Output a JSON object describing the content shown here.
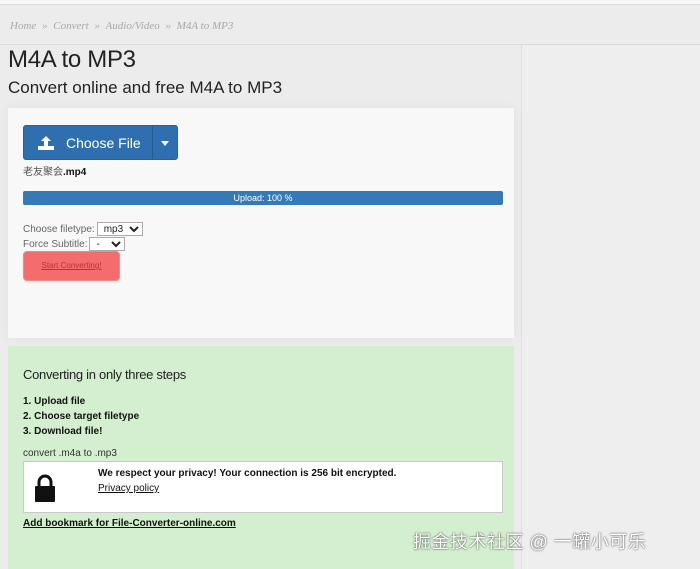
{
  "breadcrumb": [
    "Home",
    "»",
    "Convert",
    "»",
    "Audio/Video",
    "»",
    "M4A to MP3"
  ],
  "page": {
    "title": "M4A to MP3",
    "subtitle": "Convert online and free M4A to MP3"
  },
  "upload": {
    "choose_label": "Choose File",
    "upload_icon": "upload-icon",
    "filename_prefix": "老友聚会",
    "filename_ext": ".mp4",
    "progress_text": "Upload: 100 %",
    "progress_percent": 100,
    "filetype_label": "Choose filetype:",
    "filetype_value": "mp3",
    "subtitle_label": "Force Subtitle:",
    "subtitle_value": "-",
    "start_label": "Start Converting!"
  },
  "steps": {
    "title": "Converting in only three steps",
    "items": [
      "1. Upload file",
      "2. Choose target filetype",
      "3. Download file!"
    ],
    "convert_note": "convert .m4a to .mp3"
  },
  "privacy": {
    "icon": "lock-icon",
    "message": "We respect your privacy! Your connection is 256 bit encrypted.",
    "link": "Privacy policy"
  },
  "bookmark_link": "Add bookmark for File-Converter-online.com",
  "watermark": "掘金技术社区 @ 一罐小可乐",
  "colors": {
    "primary": "#2f6fb0",
    "progress": "#337ab7",
    "start_button": "#f46c6c",
    "steps_bg": "#d4efcf"
  }
}
